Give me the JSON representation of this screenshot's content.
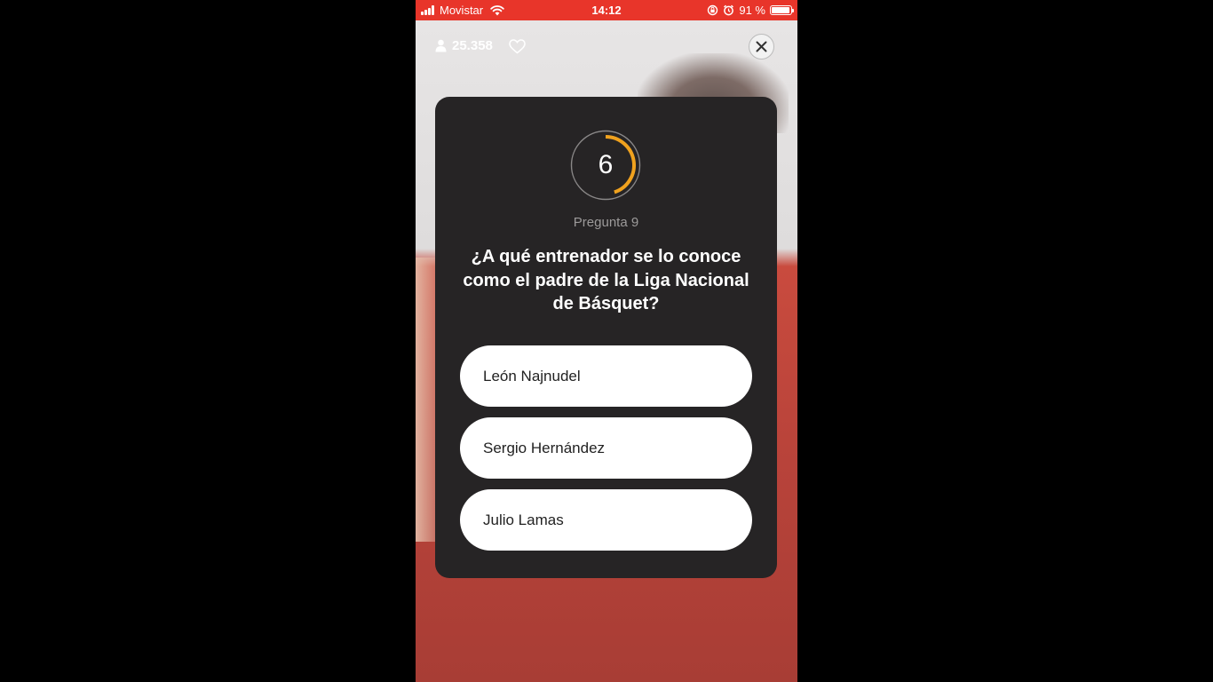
{
  "status_bar": {
    "carrier": "Movistar",
    "time": "14:12",
    "battery": "91 %"
  },
  "stream": {
    "viewers": "25.358"
  },
  "quiz": {
    "timer": "6",
    "timer_progress": 0.45,
    "question_label": "Pregunta 9",
    "question": "¿A qué entrenador se lo conoce como el padre de la Liga Nacional de Básquet?",
    "answers": [
      {
        "label": "León Najnudel"
      },
      {
        "label": "Sergio Hernández"
      },
      {
        "label": "Julio Lamas"
      }
    ]
  },
  "colors": {
    "status_bar": "#e8352a",
    "card": "#262425",
    "timer_arc": "#f0a21e"
  }
}
